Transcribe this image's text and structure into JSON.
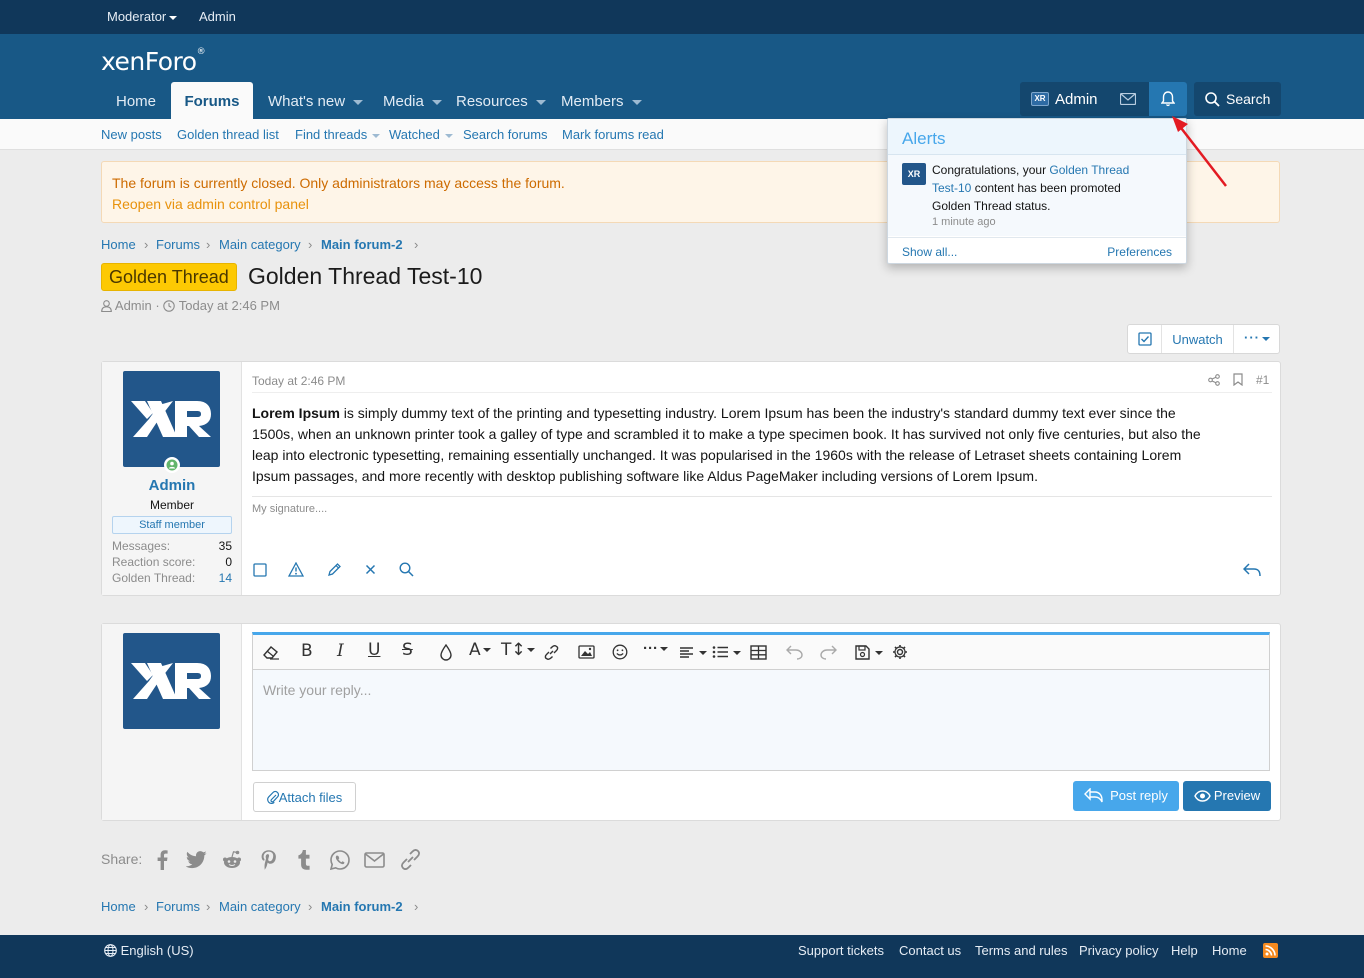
{
  "topbar": {
    "moderator": "Moderator",
    "admin": "Admin"
  },
  "header": {
    "logo": "xenForo",
    "nav": [
      {
        "label": "Home"
      },
      {
        "label": "Forums"
      },
      {
        "label": "What's new"
      },
      {
        "label": "Media"
      },
      {
        "label": "Resources"
      },
      {
        "label": "Members"
      }
    ],
    "user": "Admin",
    "search": "Search"
  },
  "subnav": [
    "New posts",
    "Golden thread list",
    "Find threads",
    "Watched",
    "Search forums",
    "Mark forums read"
  ],
  "notice": {
    "line1": "The forum is currently closed. Only administrators may access the forum.",
    "line2": "Reopen via admin control panel"
  },
  "breadcrumb": [
    "Home",
    "Forums",
    "Main category",
    "Main forum-2"
  ],
  "thread": {
    "prefix": "Golden Thread",
    "title": "Golden Thread Test-10",
    "author": "Admin",
    "sep": "·",
    "time": "Today at 2:46 PM"
  },
  "thread_actions": {
    "unwatch": "Unwatch"
  },
  "post": {
    "username": "Admin",
    "user_title": "Member",
    "banner": "Staff member",
    "stats": [
      {
        "label": "Messages:",
        "value": "35"
      },
      {
        "label": "Reaction score:",
        "value": "0"
      },
      {
        "label": "Golden Thread:",
        "value": "14"
      }
    ],
    "time": "Today at 2:46 PM",
    "number": "#1",
    "body_bold": "Lorem Ipsum",
    "body_l1": " is simply dummy text of the printing and typesetting industry. Lorem Ipsum has been the industry's standard dummy text ever since the",
    "body_l2": "1500s, when an unknown printer took a galley of type and scrambled it to make a type specimen book. It has survived not only five centuries, but also the",
    "body_l3": "leap into electronic typesetting, remaining essentially unchanged. It was popularised in the 1960s with the release of Letraset sheets containing Lorem",
    "body_l4": "Ipsum passages, and more recently with desktop publishing software like Aldus PageMaker including versions of Lorem Ipsum.",
    "signature": "My signature...."
  },
  "reply": {
    "placeholder": "Write your reply...",
    "attach": "Attach files",
    "post_reply": "Post reply",
    "preview": "Preview"
  },
  "share": {
    "label": "Share:"
  },
  "alerts": {
    "title": "Alerts",
    "msg_pre": "Congratulations, your ",
    "link1": "Golden Thread",
    "link2": "Test-10",
    "msg_mid": " content has been promoted",
    "msg_end": "Golden Thread status.",
    "time": "1 minute ago",
    "show_all": "Show all...",
    "preferences": "Preferences"
  },
  "footer": {
    "language": "English (US)",
    "links": [
      "Support tickets",
      "Contact us",
      "Terms and rules",
      "Privacy policy",
      "Help",
      "Home"
    ]
  },
  "colors": {
    "header": "#185886",
    "topbar": "#10375a",
    "link": "#2577b1",
    "prefix": "#fdc903",
    "accent": "#47a7eb"
  }
}
